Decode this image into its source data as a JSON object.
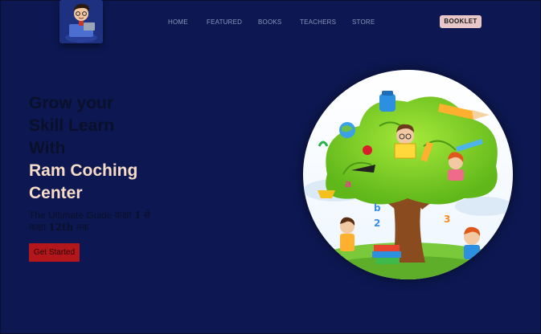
{
  "nav": {
    "items": [
      {
        "label": "HOME"
      },
      {
        "label": "FEATURED"
      },
      {
        "label": "BOOKS"
      },
      {
        "label": "TEACHERS"
      },
      {
        "label": "STORE"
      }
    ],
    "booklet_label": "BOOKLET"
  },
  "hero": {
    "title_line1": "Grow your",
    "title_line2": "Skill Learn",
    "title_line3": "With",
    "title_highlight1": "Ram Coching",
    "title_highlight2": "Center",
    "subtitle_prefix": "The Ultimate Guide कक्षा ",
    "subtitle_num1": "1",
    "subtitle_mid": " से कक्षा ",
    "subtitle_num2": "12th",
    "subtitle_suffix": " तक",
    "cta_label": "Get Started"
  },
  "colors": {
    "background": "#0d1852",
    "highlight_text": "#f6dcc7",
    "cta_background": "#b3161b",
    "booklet_background": "#e7c7c7"
  }
}
